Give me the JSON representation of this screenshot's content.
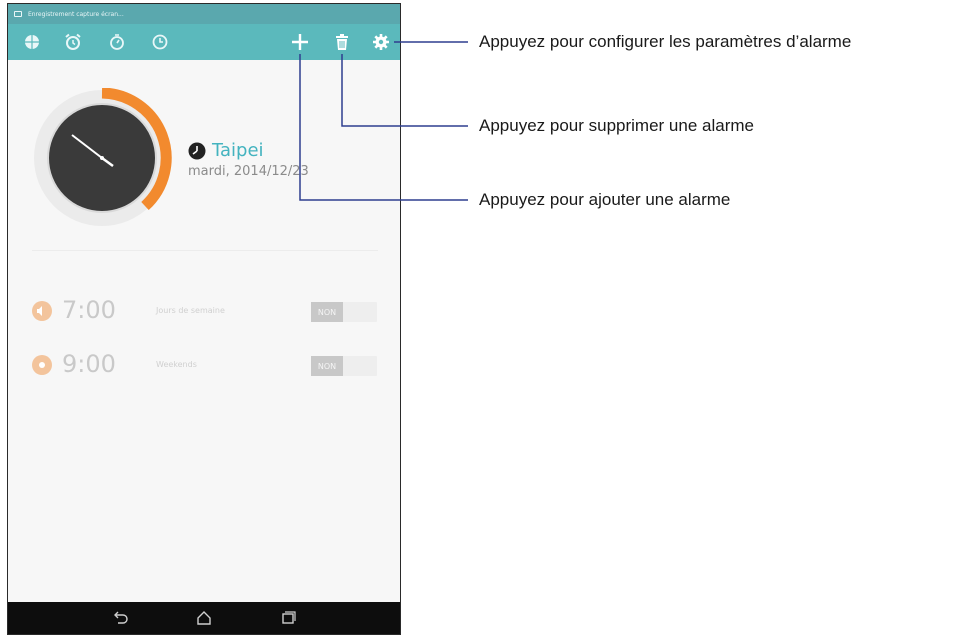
{
  "statusbar": {
    "text": "Enregistrement capture écran..."
  },
  "toolbar": {
    "icons": [
      "world-clock-icon",
      "alarm-icon",
      "stopwatch-icon",
      "timer-icon",
      "add-icon",
      "trash-icon",
      "gear-icon"
    ]
  },
  "clock": {
    "city": "Taipei",
    "date": "mardi, 2014/12/23"
  },
  "alarms": [
    {
      "time": "7:00",
      "label": "Jours de semaine",
      "toggle": "NON"
    },
    {
      "time": "9:00",
      "label": "Weekends",
      "toggle": "NON"
    }
  ],
  "callouts": {
    "settings": "Appuyez pour configurer les paramètres d’alarme",
    "delete": "Appuyez pour supprimer une alarme",
    "add": "Appuyez pour ajouter une alarme"
  },
  "colors": {
    "toolbar": "#5bb9bc",
    "accent": "#f28a2e",
    "city": "#43b3bf",
    "clock_face": "#3a3a3a"
  }
}
